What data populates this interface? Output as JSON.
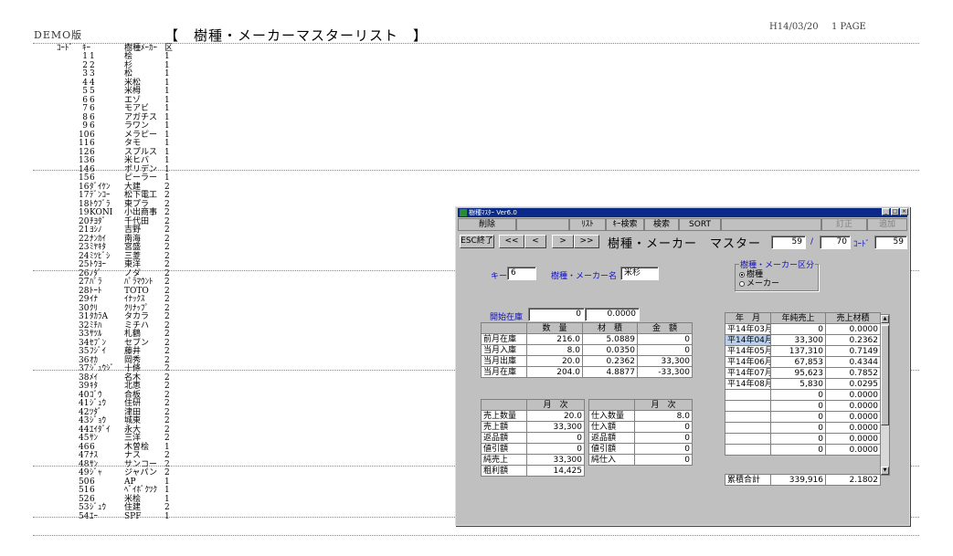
{
  "report": {
    "demo": "DEMO版",
    "title": "【　樹種・メーカーマスターリスト　】",
    "date": "H14/03/20",
    "page": "1 PAGE",
    "headers": [
      "ｺｰﾄﾞ",
      "ｷｰ",
      "樹種ﾒｰｶｰ",
      "区"
    ],
    "rows": [
      [
        "1",
        "1",
        "桧",
        "1"
      ],
      [
        "2",
        "2",
        "杉",
        "1"
      ],
      [
        "3",
        "3",
        "松",
        "1"
      ],
      [
        "4",
        "4",
        "米松",
        "1"
      ],
      [
        "5",
        "5",
        "米栂",
        "1"
      ],
      [
        "6",
        "6",
        "エゾ",
        "1"
      ],
      [
        "7",
        "6",
        "モアビ",
        "1"
      ],
      [
        "8",
        "6",
        "アガチス",
        "1"
      ],
      [
        "9",
        "6",
        "ラワン",
        "1"
      ],
      [
        "10",
        "6",
        "メラピー",
        "1"
      ],
      [
        "11",
        "6",
        "タモ",
        "1"
      ],
      [
        "12",
        "6",
        "スプルス",
        "1"
      ],
      [
        "13",
        "6",
        "米ヒバ",
        "1"
      ],
      [
        "14",
        "6",
        "ポリデン",
        "1"
      ],
      [
        "15",
        "6",
        "ピーラー",
        "1"
      ],
      [
        "16",
        "ﾀﾞｲｹﾝ",
        "大建",
        "2"
      ],
      [
        "17",
        "ﾃﾞﾝｺｰ",
        "松下電工",
        "2"
      ],
      [
        "18",
        "ﾄｳﾌﾞﾗ",
        "東プラ",
        "2"
      ],
      [
        "19",
        "KONI",
        "小出商事",
        "2"
      ],
      [
        "20",
        "ﾁﾖﾀﾞ",
        "千代田",
        "2"
      ],
      [
        "21",
        "ﾖｼﾉ",
        "吉野",
        "2"
      ],
      [
        "22",
        "ﾅﾝｶｲ",
        "南海",
        "2"
      ],
      [
        "23",
        "ﾐﾔｷﾀ",
        "宮盛",
        "2"
      ],
      [
        "24",
        "ﾐﾂﾋﾞｼ",
        "三菱",
        "2"
      ],
      [
        "25",
        "ﾄｳﾖｰ",
        "東洋",
        "2"
      ],
      [
        "26",
        "ﾉﾀﾞ",
        "ノダ",
        "2"
      ],
      [
        "27",
        "ﾊﾟﾗ",
        "ﾊﾟﾗﾏｳﾝﾄ",
        "2"
      ],
      [
        "28",
        "ﾄｰﾄ",
        "TOTO",
        "2"
      ],
      [
        "29",
        "ｲﾅ",
        "ｲﾅｯｸｽ",
        "2"
      ],
      [
        "30",
        "ｸﾘ",
        "ｸﾘﾅｯﾌﾟ",
        "2"
      ],
      [
        "31",
        "ﾀｶﾗA",
        "タカラ",
        "2"
      ],
      [
        "32",
        "ﾐﾁﾊ",
        "ミチハ",
        "2"
      ],
      [
        "33",
        "ｻﾂﾙ",
        "札鶴",
        "2"
      ],
      [
        "34",
        "ｾﾌﾞﾝ",
        "セブン",
        "2"
      ],
      [
        "35",
        "ﾌｼﾞｲ",
        "藤井",
        "2"
      ],
      [
        "36",
        "ｵｶ",
        "岡秀",
        "2"
      ],
      [
        "37",
        "ｼﾞｭｳｼﾞ",
        "十條",
        "2"
      ],
      [
        "38",
        "ﾒｲ",
        "名木",
        "2"
      ],
      [
        "39",
        "ｷﾀ",
        "北恵",
        "2"
      ],
      [
        "40",
        "ｺﾞｳ",
        "合板",
        "2"
      ],
      [
        "41",
        "ｼﾞｭｳ",
        "住研",
        "2"
      ],
      [
        "42",
        "ﾂﾀﾞ",
        "津田",
        "2"
      ],
      [
        "43",
        "ｼﾞｮｳ",
        "城東",
        "2"
      ],
      [
        "44",
        "ｴｲﾀﾞｲ",
        "永大",
        "2"
      ],
      [
        "45",
        "ｻﾝ",
        "三洋",
        "2"
      ],
      [
        "46",
        "6",
        "木曽桧",
        "1"
      ],
      [
        "47",
        "ﾅｽ",
        "ナス",
        "2"
      ],
      [
        "48",
        "ｻﾝ",
        "サンコー",
        "2"
      ],
      [
        "49",
        "ｼﾞｬ",
        "ジャパン",
        "2"
      ],
      [
        "50",
        "6",
        "AP",
        "1"
      ],
      [
        "51",
        "6",
        "ﾍﾞｲﾎﾞｸﾂｸ",
        "1"
      ],
      [
        "52",
        "6",
        "米桧",
        "1"
      ],
      [
        "53",
        "ｼﾞｭｳ",
        "住建",
        "2"
      ],
      [
        "54",
        "ｴｰ",
        "SPF",
        "1"
      ]
    ]
  },
  "window": {
    "title": "樹種ﾏｽﾀｰ Ver6.0",
    "menu": [
      "削除",
      "",
      "ﾘｽﾄ",
      "ｷｰ検索",
      "検索",
      "SORT",
      "",
      "訂正",
      "追加"
    ],
    "toolbar": {
      "esc": "ESC終了",
      "first": "<<",
      "prev": "<",
      "next": ">",
      "last": ">>"
    },
    "form_title": "樹種・メーカー　マスター",
    "rec_current": "59",
    "rec_sep": "/",
    "rec_total": "70",
    "code_label": "ｺｰﾄﾞ",
    "code_value": "59",
    "key_label": "キー",
    "key_value": "6",
    "name_label": "樹種・メーカー名",
    "name_value": "米杉",
    "group": {
      "label": "樹種・メーカー区分",
      "options": [
        "樹種",
        "メーカー"
      ],
      "selected": 0
    },
    "opening": {
      "label": "開始在庫",
      "qty": "0",
      "vol": "0.0000"
    },
    "stock": {
      "headers": [
        "数　量",
        "材　積",
        "金　額"
      ],
      "rows": [
        [
          "前月在庫",
          "216.0",
          "5.0889",
          "0"
        ],
        [
          "当月入庫",
          "8.0",
          "0.0350",
          "0"
        ],
        [
          "当月出庫",
          "20.0",
          "0.2362",
          "33,300"
        ],
        [
          "当月在庫",
          "204.0",
          "4.8877",
          "-33,300"
        ]
      ]
    },
    "monthly_sales": {
      "header": "月　次",
      "rows": [
        [
          "売上数量",
          "20.0"
        ],
        [
          "売上額",
          "33,300"
        ],
        [
          "返品額",
          "0"
        ],
        [
          "値引額",
          "0"
        ],
        [
          "純売上",
          "33,300"
        ],
        [
          "粗利額",
          "14,425"
        ]
      ]
    },
    "monthly_purchase": {
      "header": "月　次",
      "rows": [
        [
          "仕入数量",
          "8.0"
        ],
        [
          "仕入額",
          "0"
        ],
        [
          "返品額",
          "0"
        ],
        [
          "値引額",
          "0"
        ],
        [
          "純仕入",
          "0"
        ]
      ]
    },
    "history": {
      "headers": [
        "年　月",
        "年純売上",
        "売上材積"
      ],
      "rows": [
        [
          "平14年03月",
          "0",
          "0.0000"
        ],
        [
          "平14年04月",
          "33,300",
          "0.2362"
        ],
        [
          "平14年05月",
          "137,310",
          "0.7149"
        ],
        [
          "平14年06月",
          "67,853",
          "0.4344"
        ],
        [
          "平14年07月",
          "95,623",
          "0.7852"
        ],
        [
          "平14年08月",
          "5,830",
          "0.0295"
        ],
        [
          "",
          "0",
          "0.0000"
        ],
        [
          "",
          "0",
          "0.0000"
        ],
        [
          "",
          "0",
          "0.0000"
        ],
        [
          "",
          "0",
          "0.0000"
        ],
        [
          "",
          "0",
          "0.0000"
        ],
        [
          "",
          "0",
          "0.0000"
        ]
      ],
      "selected_row": 1,
      "total": [
        "累積合計",
        "339,916",
        "2.1802"
      ]
    }
  }
}
